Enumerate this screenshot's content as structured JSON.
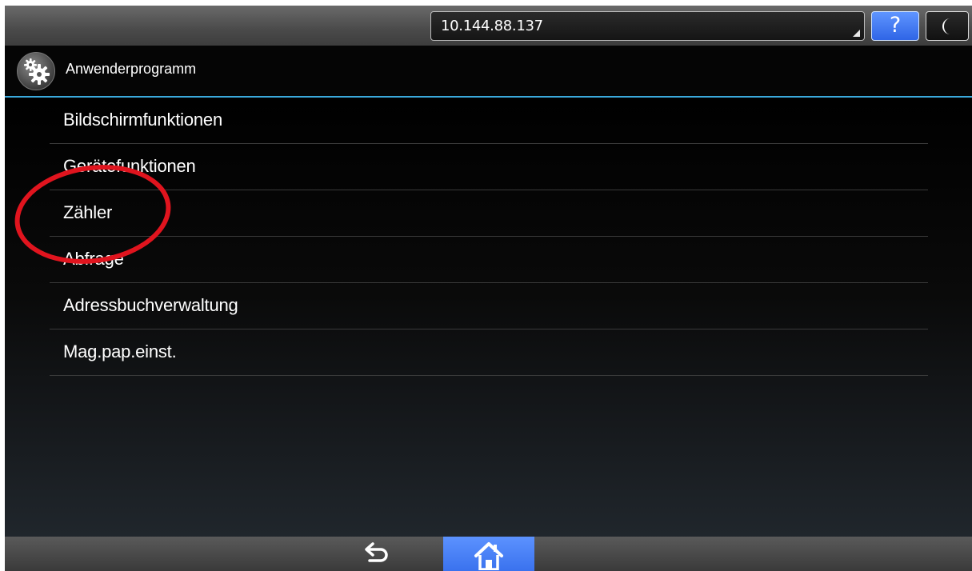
{
  "topbar": {
    "address": "10.144.88.137",
    "help_label": "?"
  },
  "header": {
    "title": "Anwenderprogramm"
  },
  "menu": {
    "items": [
      {
        "label": "Bildschirmfunktionen"
      },
      {
        "label": "Gerätefunktionen"
      },
      {
        "label": "Zähler"
      },
      {
        "label": "Abfrage"
      },
      {
        "label": "Adressbuchverwaltung"
      },
      {
        "label": "Mag.pap.einst."
      }
    ]
  },
  "icons": {
    "header": "gears-icon",
    "sleep": "moon-icon",
    "back": "back-arrow-icon",
    "home": "home-icon"
  },
  "colors": {
    "accent_line": "#3aa9dc",
    "help_button": "#3f78f0",
    "home_button": "#4a80f5",
    "annotation": "#e0141e"
  }
}
